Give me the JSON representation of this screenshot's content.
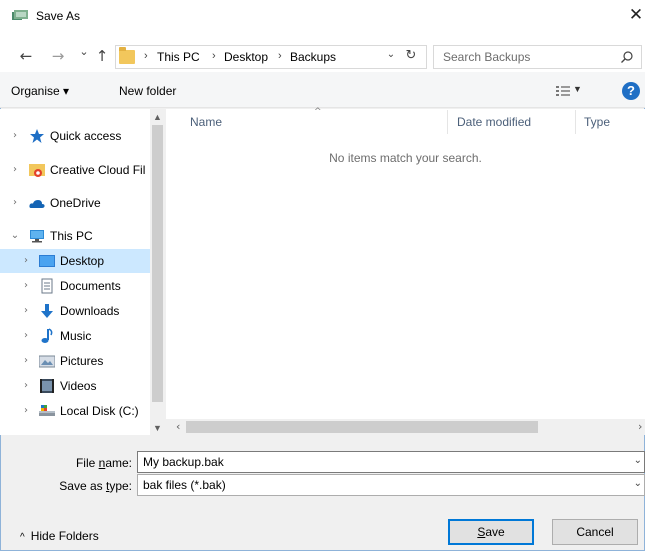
{
  "window": {
    "title": "Save As"
  },
  "navigation": {
    "back": "←",
    "forward": "→",
    "recent": "⌄",
    "up": "↑",
    "breadcrumbs": [
      "This PC",
      "Desktop",
      "Backups"
    ],
    "separator": "›",
    "search_placeholder": "Search Backups"
  },
  "toolbar": {
    "organise": "Organise ▾",
    "new_folder": "New folder",
    "help": "?"
  },
  "tree": [
    {
      "label": "Quick access",
      "icon": "star-icon",
      "chevron": "›"
    },
    {
      "label": "Creative Cloud Fil",
      "icon": "creative-cloud-folder-icon",
      "chevron": "›"
    },
    {
      "label": "OneDrive",
      "icon": "cloud-icon",
      "chevron": "›"
    },
    {
      "label": "This PC",
      "icon": "computer-icon",
      "chevron": "⌄"
    },
    {
      "label": "Desktop",
      "icon": "desktop-icon",
      "chevron": "›",
      "selected": true
    },
    {
      "label": "Documents",
      "icon": "documents-icon",
      "chevron": "›"
    },
    {
      "label": "Downloads",
      "icon": "download-icon",
      "chevron": "›"
    },
    {
      "label": "Music",
      "icon": "music-icon",
      "chevron": "›"
    },
    {
      "label": "Pictures",
      "icon": "pictures-icon",
      "chevron": "›"
    },
    {
      "label": "Videos",
      "icon": "videos-icon",
      "chevron": "›"
    },
    {
      "label": "Local Disk (C:)",
      "icon": "drive-icon",
      "chevron": "›"
    }
  ],
  "columns": {
    "name": "Name",
    "date_modified": "Date modified",
    "type": "Type"
  },
  "empty_message": "No items match your search.",
  "form": {
    "file_name_label_pre": "File ",
    "file_name_label_u": "n",
    "file_name_label_post": "ame:",
    "file_name_value": "My backup.bak",
    "save_type_label_pre": "Save as ",
    "save_type_label_u": "t",
    "save_type_label_post": "ype:",
    "save_type_value": "bak files (*.bak)"
  },
  "footer": {
    "hide_folders": "Hide Folders",
    "save_u": "S",
    "save_rest": "ave",
    "cancel": "Cancel"
  },
  "colors": {
    "accent": "#0078d7",
    "selection": "#cce8ff",
    "help": "#1f6fc5"
  }
}
